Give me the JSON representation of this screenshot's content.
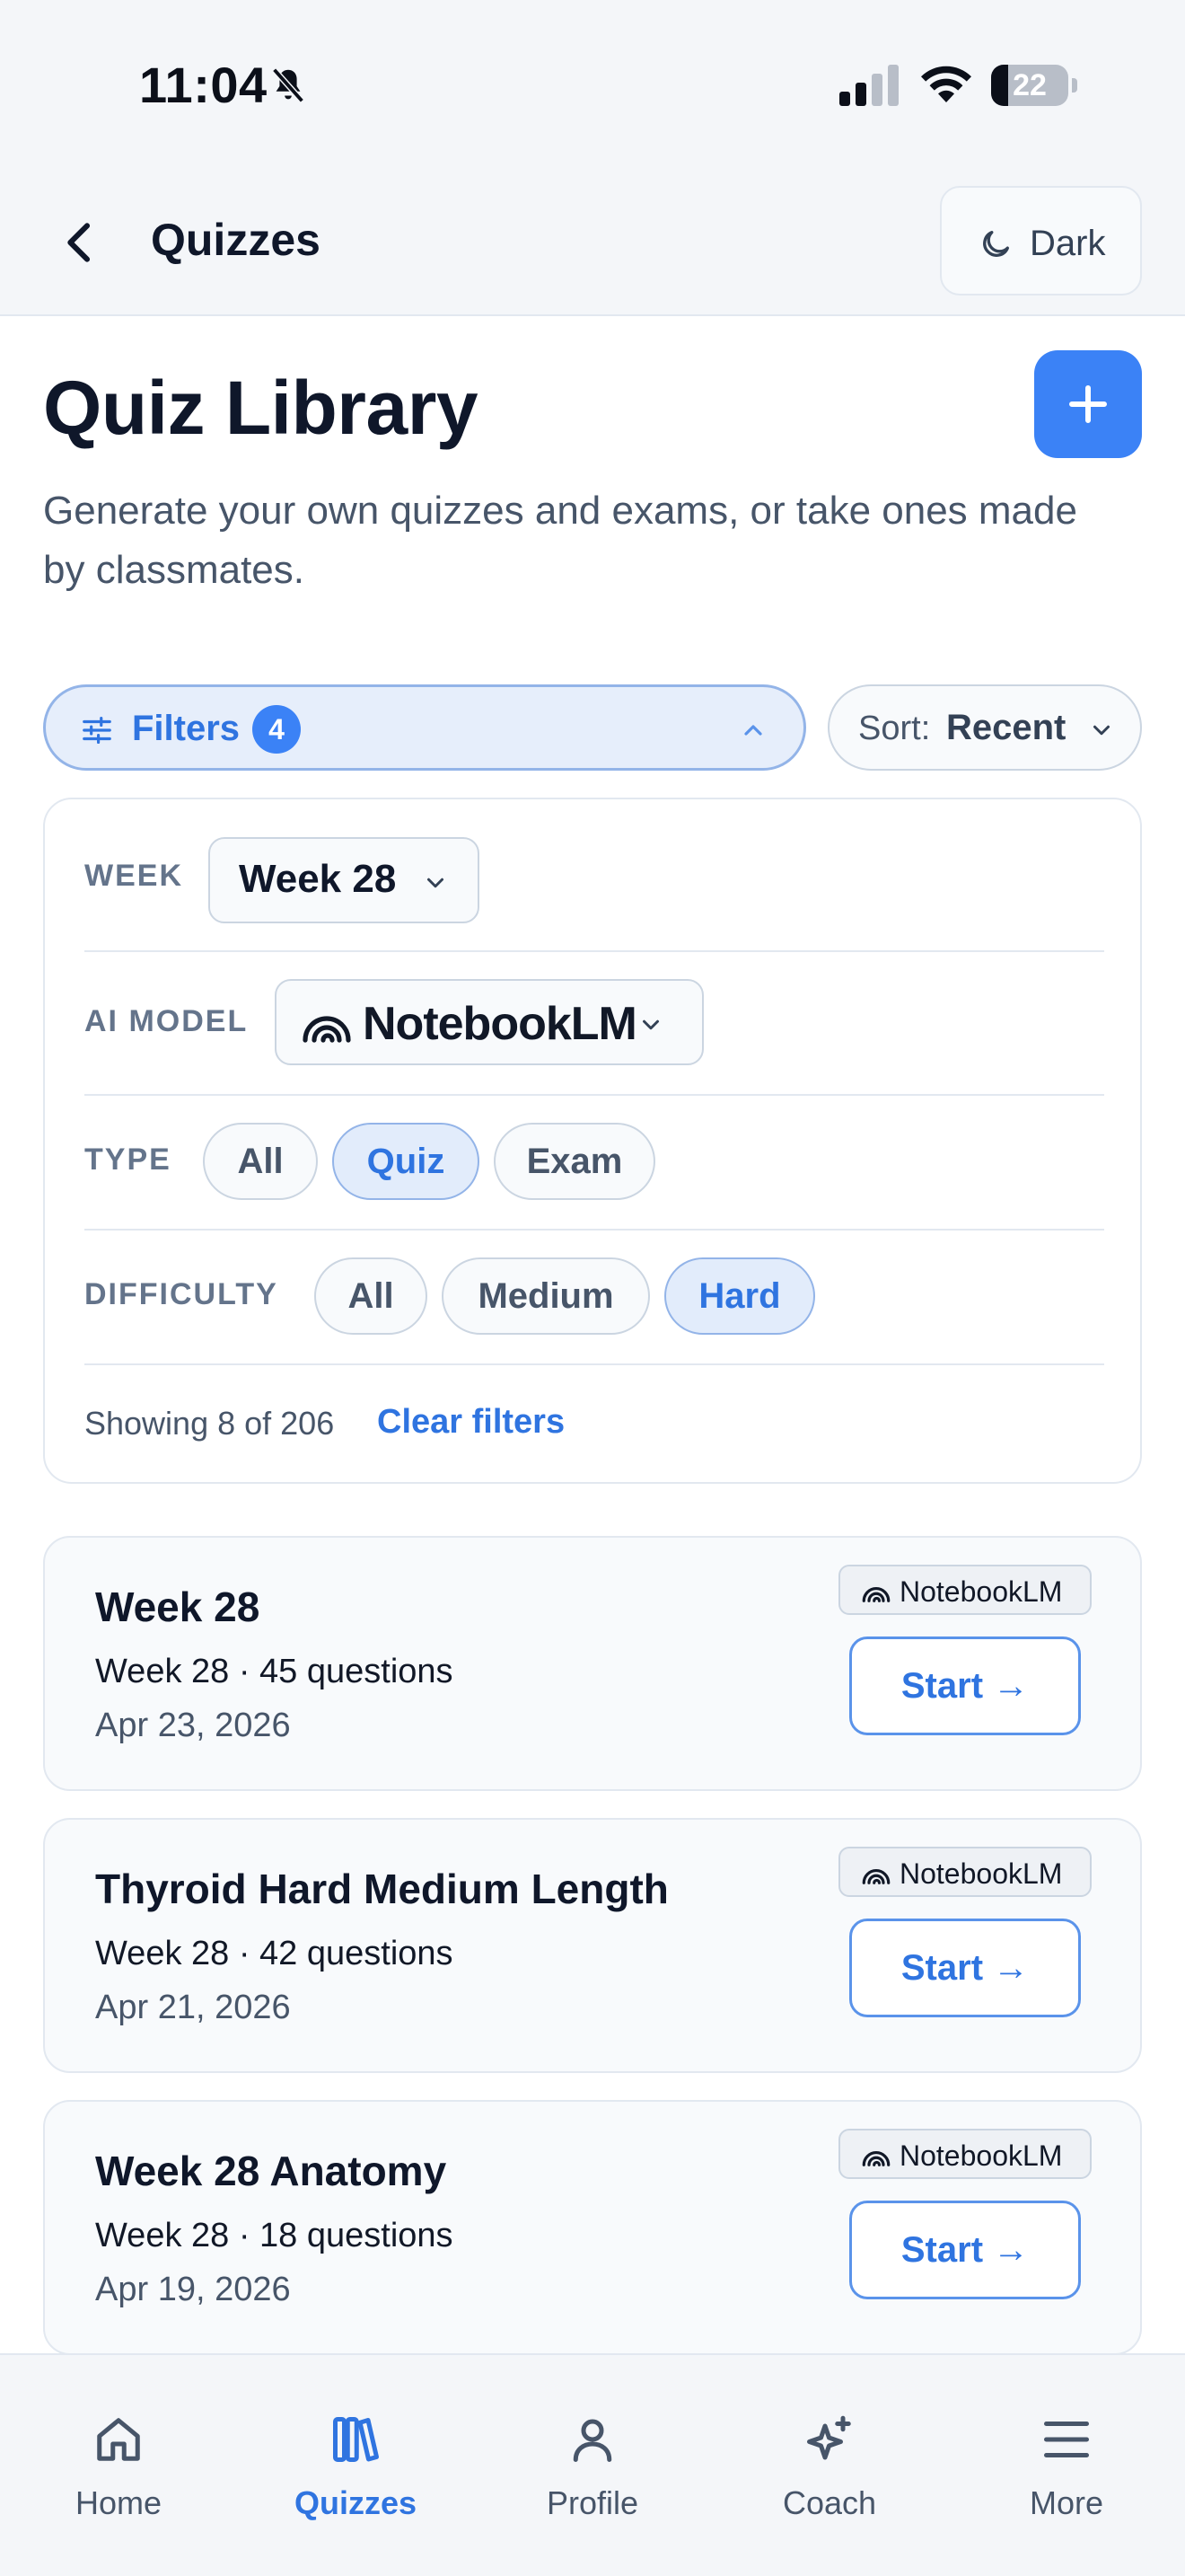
{
  "status_bar": {
    "time": "11:04",
    "battery": "22",
    "battery_level": 0.22
  },
  "navbar": {
    "title": "Quizzes",
    "theme_toggle_label": "Dark"
  },
  "header": {
    "title": "Quiz Library",
    "subtitle": "Generate your own quizzes and exams, or take ones made by classmates."
  },
  "toolbar": {
    "filters_label": "Filters",
    "filters_count": "4",
    "sort_prefix": "Sort:",
    "sort_value": "Recent"
  },
  "filters": {
    "week": {
      "label": "WEEK",
      "value": "Week 28"
    },
    "ai_model": {
      "label": "AI MODEL",
      "value": "NotebookLM"
    },
    "type": {
      "label": "TYPE",
      "options": [
        {
          "label": "All",
          "active": false
        },
        {
          "label": "Quiz",
          "active": true
        },
        {
          "label": "Exam",
          "active": false
        }
      ]
    },
    "difficulty": {
      "label": "DIFFICULTY",
      "options": [
        {
          "label": "All",
          "active": false
        },
        {
          "label": "Medium",
          "active": false
        },
        {
          "label": "Hard",
          "active": true
        }
      ]
    },
    "summary": "Showing 8 of 206",
    "clear_label": "Clear filters"
  },
  "quizzes": [
    {
      "title": "Week 28",
      "meta": "Week 28 · 45 questions",
      "date": "Apr 23, 2026",
      "model": "NotebookLM",
      "action": "Start →"
    },
    {
      "title": "Thyroid Hard Medium Length",
      "meta": "Week 28 · 42 questions",
      "date": "Apr 21, 2026",
      "model": "NotebookLM",
      "action": "Start →"
    },
    {
      "title": "Week 28 Anatomy",
      "meta": "Week 28 · 18 questions",
      "date": "Apr 19, 2026",
      "model": "NotebookLM",
      "action": "Start →"
    }
  ],
  "tab_bar": {
    "items": [
      {
        "label": "Home",
        "icon": "home-icon",
        "active": false
      },
      {
        "label": "Quizzes",
        "icon": "books-icon",
        "active": true
      },
      {
        "label": "Profile",
        "icon": "person-icon",
        "active": false
      },
      {
        "label": "Coach",
        "icon": "sparkles-icon",
        "active": false
      },
      {
        "label": "More",
        "icon": "menu-icon",
        "active": false
      }
    ]
  },
  "colors": {
    "accent": "#3b82f6",
    "accent_text": "#2f74e0",
    "chip_active_bg": "#e2ecfb"
  }
}
